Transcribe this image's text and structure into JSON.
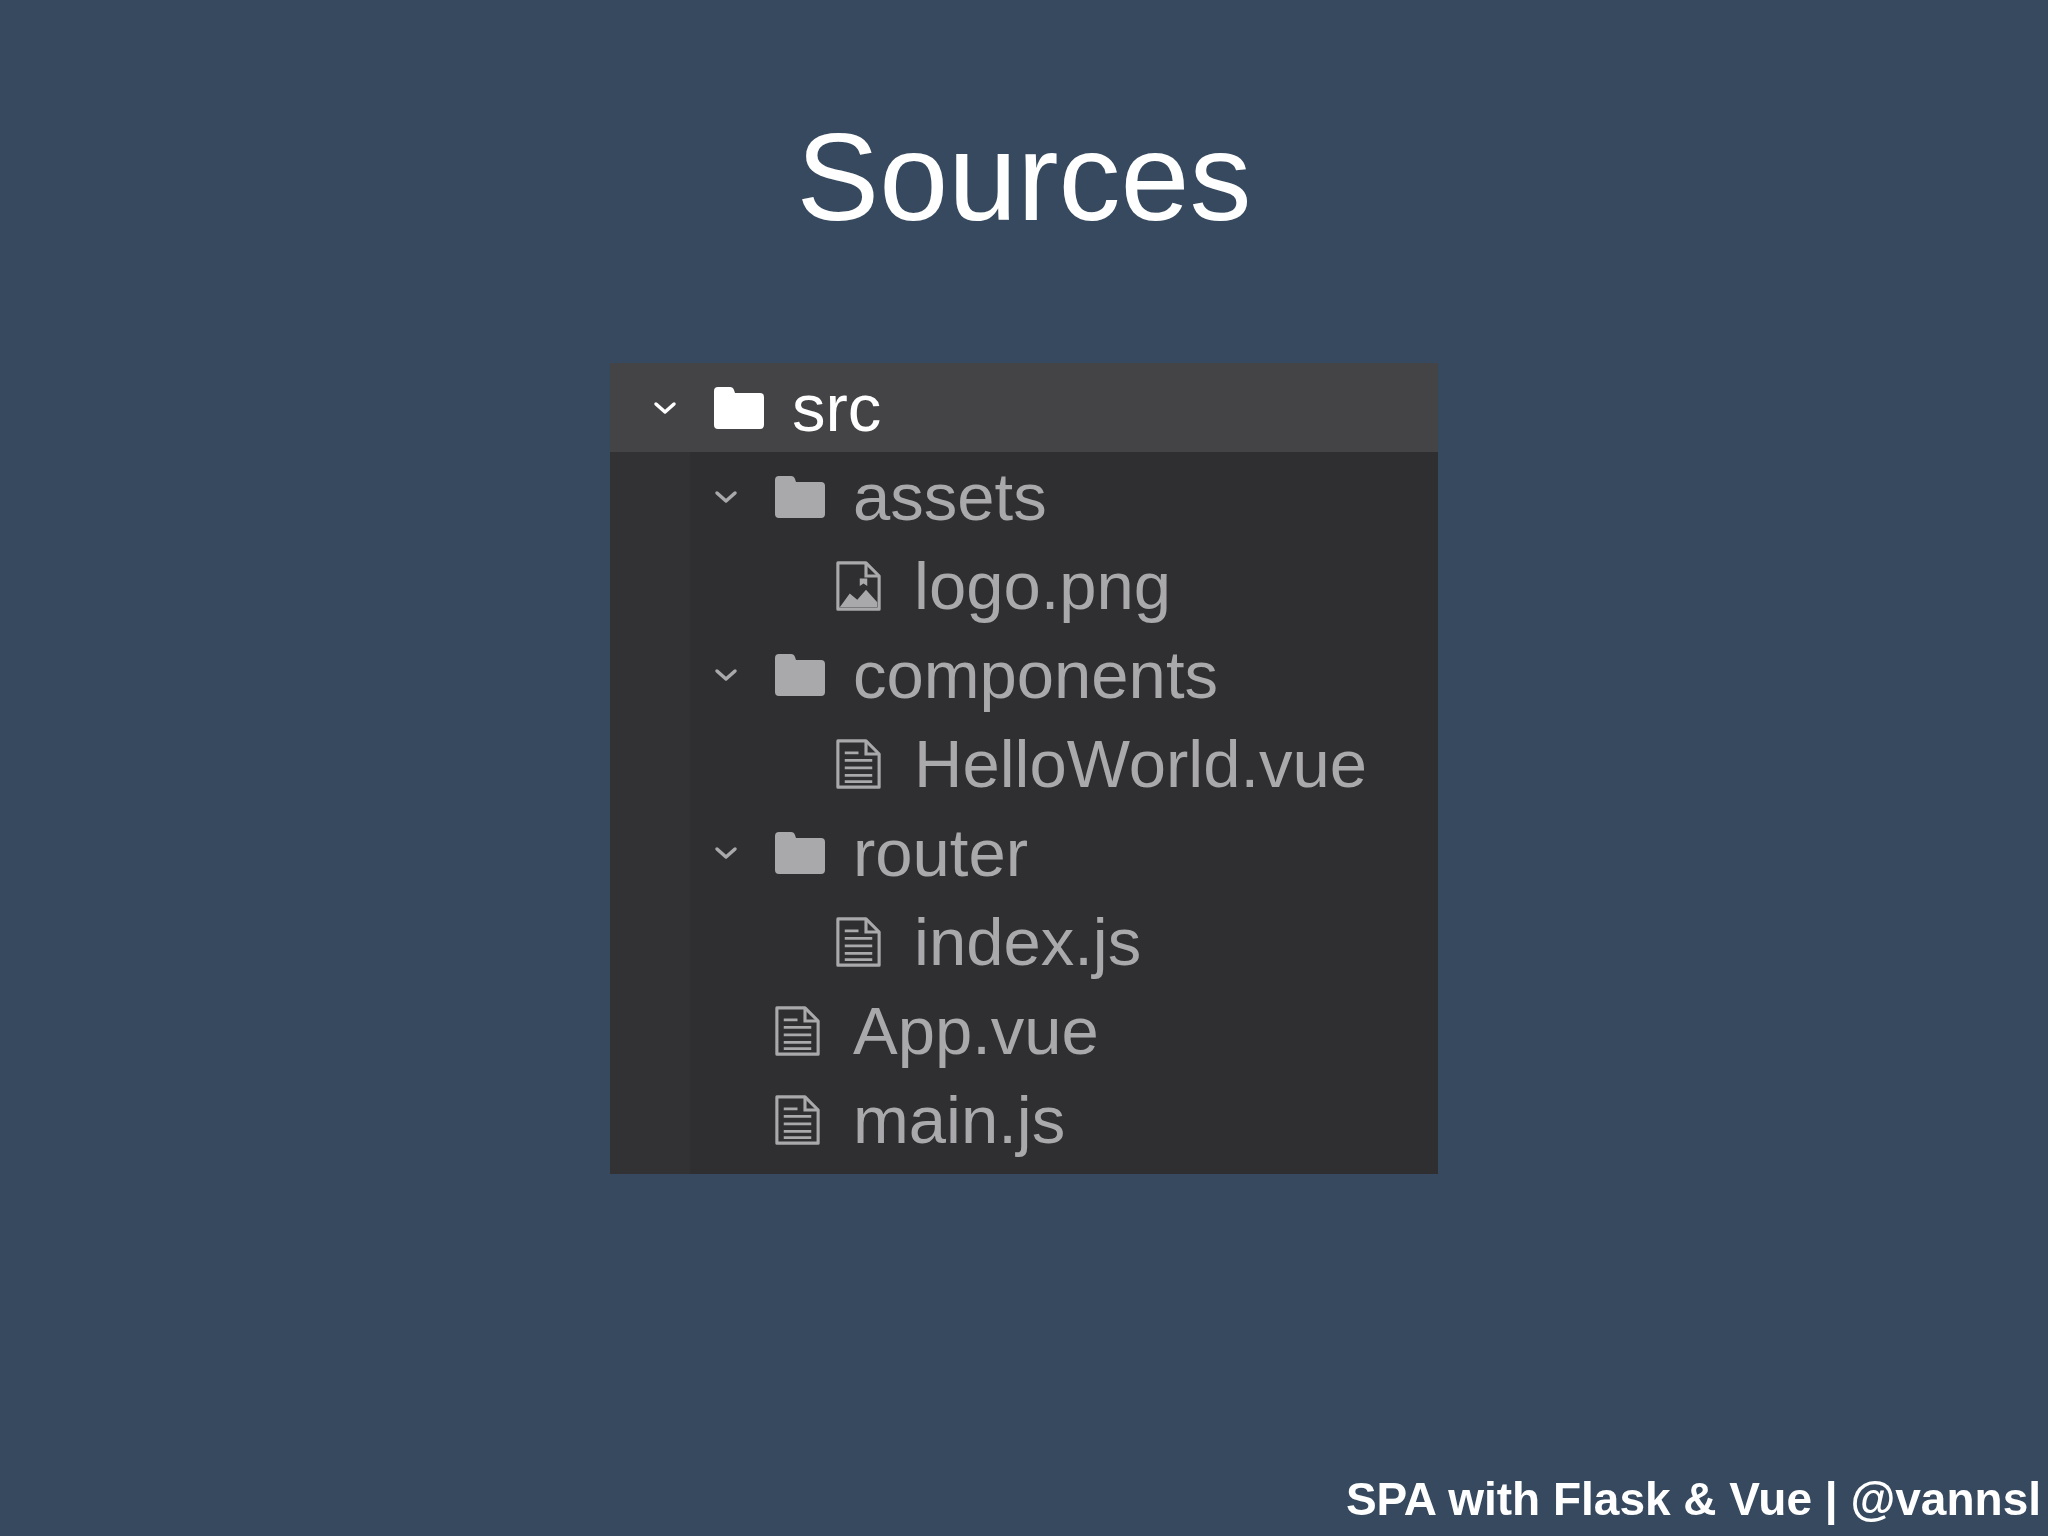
{
  "title": "Sources",
  "tree": [
    {
      "name": "src",
      "kind": "folder",
      "expanded": true,
      "selected": true,
      "children": [
        {
          "name": "assets",
          "kind": "folder",
          "expanded": true,
          "selected": false,
          "children": [
            {
              "name": "logo.png",
              "kind": "image",
              "selected": false
            }
          ]
        },
        {
          "name": "components",
          "kind": "folder",
          "expanded": true,
          "selected": false,
          "children": [
            {
              "name": "HelloWorld.vue",
              "kind": "file",
              "selected": false
            }
          ]
        },
        {
          "name": "router",
          "kind": "folder",
          "expanded": true,
          "selected": false,
          "children": [
            {
              "name": "index.js",
              "kind": "file",
              "selected": false
            }
          ]
        },
        {
          "name": "App.vue",
          "kind": "file",
          "selected": false
        },
        {
          "name": "main.js",
          "kind": "file",
          "selected": false
        }
      ]
    }
  ],
  "footer": "SPA with Flask & Vue | @vannsl"
}
